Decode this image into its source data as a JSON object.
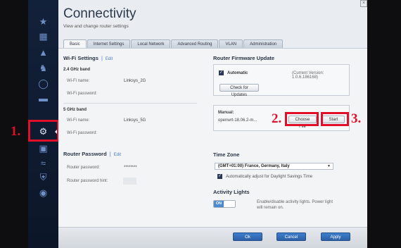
{
  "app": {
    "title": "Connectivity",
    "subtitle": "View and change router settings"
  },
  "tabs": [
    "Basic",
    "Internet Settings",
    "Local Network",
    "Advanced Routing",
    "VLAN",
    "Administration"
  ],
  "wifi": {
    "title": "Wi-Fi Settings",
    "separator": "|",
    "edit": "Edit",
    "band24": {
      "label": "2.4 GHz band",
      "name_label": "Wi-Fi name:",
      "name_value": "Linksys_2G",
      "password_label": "Wi-Fi password:"
    },
    "band5": {
      "label": "5 GHz band",
      "name_label": "Wi-Fi name:",
      "name_value": "Linksys_5G",
      "password_label": "Wi-Fi password:"
    }
  },
  "router_password": {
    "title": "Router Password",
    "separator": "|",
    "edit": "Edit",
    "password_label": "Router password:",
    "password_value": "********",
    "hint_label": "Router password hint:"
  },
  "firmware": {
    "title": "Router Firmware Update",
    "automatic_label": "Automatic",
    "automatic_checked": true,
    "current_version": "(Current Version: 1.0.6.186168)",
    "check_button": "Check for Updates",
    "manual_label": "Manual:",
    "manual_file": "openwrt-18.06.2-m...",
    "choose_button": "Choose File",
    "start_button": "Start"
  },
  "timezone": {
    "title": "Time Zone",
    "selected": "(GMT+01:00) France, Germany, Italy",
    "dst_label": "Automatically adjust for Daylight Savings Time",
    "dst_checked": true
  },
  "activity_lights": {
    "title": "Activity Lights",
    "toggle_label": "ON",
    "description": "Enable/disable activity lights. Power light will remain on."
  },
  "footer": {
    "ok": "Ok",
    "cancel": "Cancel",
    "apply": "Apply"
  },
  "annotations": {
    "step1": "1.",
    "step2": "2.",
    "step3": "3."
  },
  "colors": {
    "annotation": "#e0102a",
    "sidebar": "#12213a",
    "accent": "#2b5fa5"
  },
  "sidebar_icons": [
    "network-map-icon",
    "devices-icon",
    "alert-icon",
    "parental-controls-icon",
    "speed-icon",
    "external-storage-icon",
    "connectivity-gear-icon",
    "camera-icon",
    "wireless-icon",
    "security-shield-icon",
    "linksys-icon"
  ]
}
